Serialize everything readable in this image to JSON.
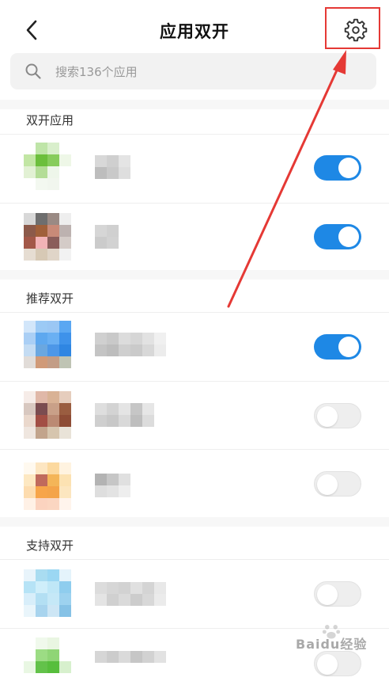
{
  "header": {
    "title": "应用双开",
    "back_icon": "chevron-left-icon",
    "settings_icon": "gear-icon"
  },
  "search": {
    "placeholder": "搜索136个应用",
    "icon": "search-icon"
  },
  "sections": [
    {
      "label": "双开应用",
      "apps": [
        {
          "enabled": true,
          "icon_colors": [
            "#ffffff",
            "#bfe5a8",
            "#d9efcc",
            "#ffffff",
            "#c2e6a4",
            "#6cbf3c",
            "#87cc5c",
            "#eef7e7",
            "#e2f1d4",
            "#b4dd97",
            "#eef6ea",
            "#ffffff",
            "#ffffff",
            "#f3f8f0",
            "#f1f6ee",
            "#ffffff"
          ],
          "name_colors": [
            "#d8d8d8",
            "#cfcfcf",
            "#e4e4e4",
            "#ffffff",
            "#ffffff",
            "#ffffff",
            "#bdbdbd",
            "#c9c9c9",
            "#dedede",
            "#ffffff",
            "#ffffff",
            "#ffffff"
          ]
        },
        {
          "enabled": true,
          "icon_colors": [
            "#d8d8d8",
            "#6e6e6e",
            "#9a8a84",
            "#eeeeee",
            "#8c5a4a",
            "#a0603a",
            "#c88a78",
            "#bdb2b0",
            "#a35848",
            "#f2b3b6",
            "#8a5d5a",
            "#d4cbc7",
            "#e6ddd2",
            "#d7c9b5",
            "#e0d5c8",
            "#f2f2f2"
          ],
          "name_colors": [
            "#d6d6d6",
            "#d0d0d0",
            "#ffffff",
            "#ffffff",
            "#ffffff",
            "#ffffff",
            "#cbcbcb",
            "#d2d2d2",
            "#ffffff",
            "#ffffff",
            "#ffffff",
            "#ffffff"
          ]
        }
      ]
    },
    {
      "label": "推荐双开",
      "apps": [
        {
          "enabled": true,
          "icon_colors": [
            "#d2e6fa",
            "#9ccaf5",
            "#9bc7f4",
            "#5aa7f2",
            "#aacff5",
            "#5ea8ef",
            "#6ab0f3",
            "#3e92ea",
            "#c4dcf3",
            "#6aa7e0",
            "#4d97e8",
            "#2f86e2",
            "#e1dcd8",
            "#d09a78",
            "#c39d86",
            "#bfc4b4"
          ],
          "name_colors": [
            "#d0d0d0",
            "#c9c9c9",
            "#dcdcdc",
            "#d6d6d6",
            "#e2e2e2",
            "#f0f0f0",
            "#c4c4c4",
            "#bdbdbd",
            "#cfcfcf",
            "#cacaca",
            "#d8d8d8",
            "#ececec"
          ]
        },
        {
          "enabled": false,
          "icon_colors": [
            "#f6ece8",
            "#e0b8a8",
            "#d9b295",
            "#e6cdbd",
            "#d8c8c0",
            "#7a4c50",
            "#c9a088",
            "#9a5d40",
            "#ead8cc",
            "#a24e44",
            "#bb8a73",
            "#8e4c35",
            "#efe6df",
            "#c2a48c",
            "#d6c5ae",
            "#e9e3d8"
          ],
          "name_colors": [
            "#dedede",
            "#d3d3d3",
            "#e4e4e4",
            "#c6c6c6",
            "#e6e6e6",
            "#ffffff",
            "#cfcfcf",
            "#c8c8c8",
            "#d9d9d9",
            "#bebebe",
            "#dcdcdc",
            "#ffffff"
          ]
        },
        {
          "enabled": false,
          "icon_colors": [
            "#fff9ef",
            "#fde6c2",
            "#fcd99f",
            "#fff3e0",
            "#fde8c2",
            "#c06a5c",
            "#f4b558",
            "#fce2b2",
            "#fddcaf",
            "#f7a54a",
            "#f4a44a",
            "#fce6bf",
            "#fff1e6",
            "#fbd3bf",
            "#fbd6c1",
            "#fff4ec"
          ],
          "name_colors": [
            "#b3b3b3",
            "#c6c6c6",
            "#e0e0e0",
            "#ffffff",
            "#ffffff",
            "#ffffff",
            "#dedede",
            "#e3e3e3",
            "#eeeeee",
            "#ffffff",
            "#ffffff",
            "#ffffff"
          ]
        }
      ]
    },
    {
      "label": "支持双开",
      "apps": [
        {
          "enabled": false,
          "icon_colors": [
            "#e8f4fb",
            "#a9dcf1",
            "#9bd7f3",
            "#e4f3fb",
            "#b6e3f6",
            "#cfeefa",
            "#bfe7f7",
            "#8fcdee",
            "#d8eefa",
            "#b3dff3",
            "#c5e8f7",
            "#9dd2ef",
            "#e9f5fb",
            "#a8d4ee",
            "#cde6f5",
            "#86c2e6"
          ],
          "name_colors": [
            "#dcdcdc",
            "#d6d6d6",
            "#d2d2d2",
            "#e0e0e0",
            "#d4d4d4",
            "#e8e8e8",
            "#e4e4e4",
            "#d0d0d0",
            "#dadada",
            "#cccccc",
            "#d8d8d8",
            "#ebebeb"
          ]
        },
        {
          "enabled": false,
          "icon_colors": [
            "#ffffff",
            "#f0f9ec",
            "#e9f6e2",
            "#ffffff",
            "#ffffff",
            "#9cdc84",
            "#8fd576",
            "#ffffff",
            "#e9f7e3",
            "#63c24a",
            "#57be3c",
            "#d7f0cd",
            "#ffffff",
            "#ffffff",
            "#ffffff",
            "#ffffff"
          ],
          "name_colors": [
            "#d6d6d6",
            "#cccccc",
            "#dadada",
            "#c6c6c6",
            "#d2d2d2",
            "#e2e2e2",
            "#ffffff",
            "#ffffff",
            "#ffffff",
            "#ffffff",
            "#ffffff",
            "#ffffff"
          ]
        }
      ]
    }
  ],
  "annotation": {
    "color": "#e53935"
  },
  "watermark": {
    "text": "Baidu经验",
    "icon": "baidu-paw-icon"
  },
  "colors": {
    "toggle_on": "#1e88e5",
    "toggle_off": "#eeeeee"
  }
}
